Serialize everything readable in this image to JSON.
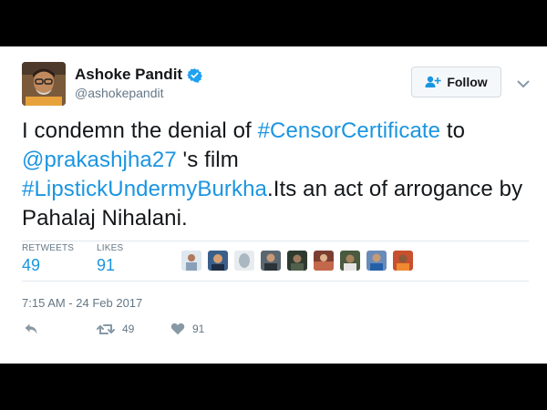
{
  "tweet": {
    "author": {
      "display_name": "Ashoke Pandit",
      "handle": "@ashokepandit",
      "verified": true
    },
    "follow_label": "Follow",
    "text_segments": [
      {
        "text": "I condemn the denial of ",
        "type": "text"
      },
      {
        "text": "#CensorCertificate",
        "type": "hashtag"
      },
      {
        "text": " to ",
        "type": "text"
      },
      {
        "text": "@prakashjha27",
        "type": "mention"
      },
      {
        "text": " 's film ",
        "type": "text"
      },
      {
        "text": "#LipstickUndermyBurkha",
        "type": "hashtag"
      },
      {
        "text": ".Its an act of arrogance by Pahalaj Nihalani.",
        "type": "text"
      }
    ],
    "stats": {
      "retweets_label": "RETWEETS",
      "retweets_value": "49",
      "likes_label": "LIKES",
      "likes_value": "91"
    },
    "liker_avatar_count": 9,
    "timestamp": "7:15 AM - 24 Feb 2017",
    "actions": {
      "reply_icon": "reply-icon",
      "retweet_icon": "retweet-icon",
      "retweet_count": "49",
      "like_icon": "heart-icon",
      "like_count": "91"
    }
  },
  "colors": {
    "link": "#1b95e0",
    "verified": "#1da1f2",
    "text": "#14171a",
    "muted": "#657786",
    "background_frame": "#000000"
  }
}
